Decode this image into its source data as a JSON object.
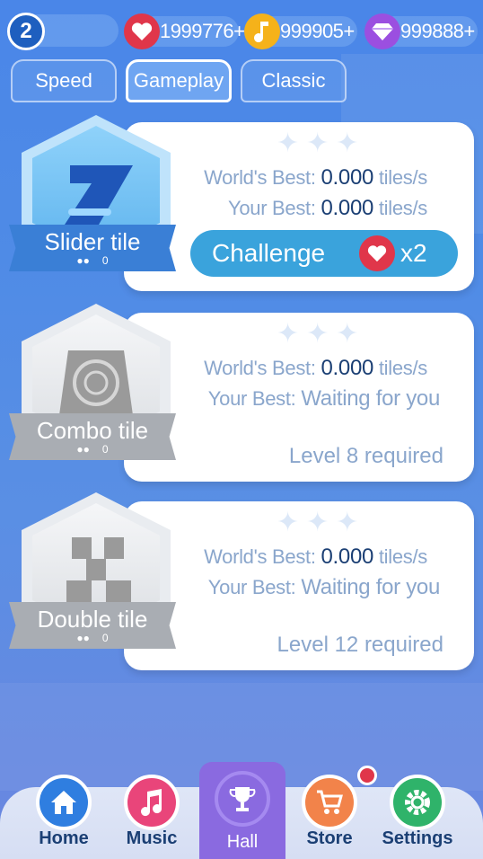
{
  "topbar": {
    "level": "2",
    "hearts": "1999776+",
    "notes": "999905+",
    "gems": "999888+"
  },
  "tabs": [
    {
      "label": "Speed"
    },
    {
      "label": "Gameplay"
    },
    {
      "label": "Classic"
    }
  ],
  "cards": [
    {
      "title": "Slider tile",
      "players": "0",
      "world_label": "World's Best:",
      "world_value": "0.000",
      "world_unit": "tiles/s",
      "your_label": "Your Best:",
      "your_value": "0.000",
      "your_unit": "tiles/s",
      "challenge_label": "Challenge",
      "challenge_multiplier": "x2"
    },
    {
      "title": "Combo tile",
      "players": "0",
      "world_label": "World's Best:",
      "world_value": "0.000",
      "world_unit": "tiles/s",
      "your_label": "Your Best:",
      "your_value": "Waiting for you",
      "requirement": "Level 8 required"
    },
    {
      "title": "Double tile",
      "players": "0",
      "world_label": "World's Best:",
      "world_value": "0.000",
      "world_unit": "tiles/s",
      "your_label": "Your Best:",
      "your_value": "Waiting for you",
      "requirement": "Level 12 required"
    }
  ],
  "nav": [
    {
      "label": "Home"
    },
    {
      "label": "Music"
    },
    {
      "label": "Hall"
    },
    {
      "label": "Store"
    },
    {
      "label": "Settings"
    }
  ],
  "colors": {
    "accent_blue": "#3aa3dc",
    "heart_red": "#e0364a",
    "note_gold": "#f5b21a",
    "gem_purple": "#9b4fe0",
    "hall_purple": "#8a6ae0",
    "text_dark": "#1b3f74",
    "text_muted": "#8aa6cc"
  }
}
